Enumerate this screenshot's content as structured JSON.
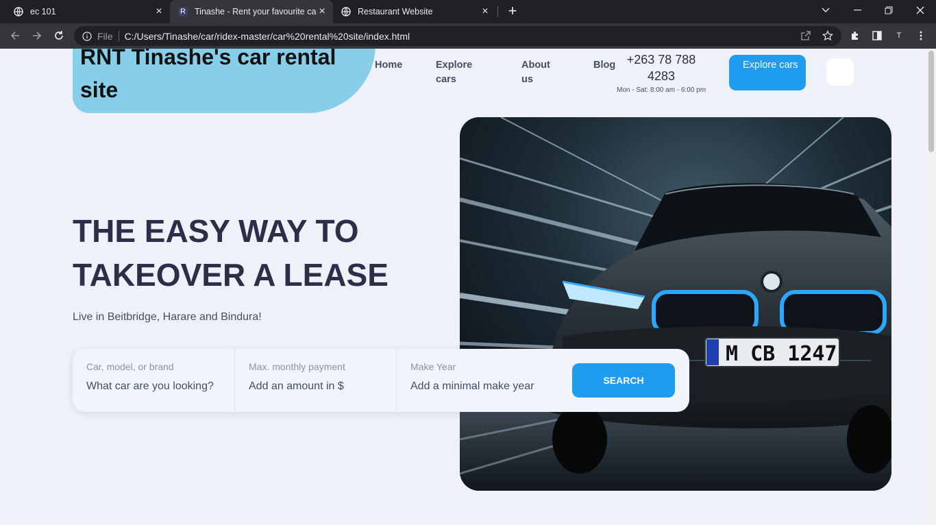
{
  "browser": {
    "tabs": [
      {
        "title": "ec 101",
        "icon": "globe-icon"
      },
      {
        "title": "Tinashe - Rent your favourite car",
        "icon": "r-letter-icon",
        "favicon_letter": "R",
        "active": true
      },
      {
        "title": "Restaurant Website",
        "icon": "globe-icon"
      }
    ],
    "address": {
      "scheme": "File",
      "url": "C:/Users/Tinashe/car/ridex-master/car%20rental%20site/index.html"
    },
    "profile_initial": "T"
  },
  "header": {
    "brand": "RNT Tinashe's car rental site",
    "nav": [
      "Home",
      "Explore cars",
      "About us",
      "Blog"
    ],
    "phone": "+263 78 788 4283",
    "hours": "Mon - Sat: 8:00 am - 6:00 pm",
    "cta": "Explore cars"
  },
  "hero": {
    "title": "THE EASY WAY TO TAKEOVER A LEASE",
    "subtitle": "Live in Beitbridge, Harare and Bindura!",
    "license_plate": "M CB 1247"
  },
  "search": {
    "fields": [
      {
        "label": "Car, model, or brand",
        "placeholder": "What car are you looking?"
      },
      {
        "label": "Max. monthly payment",
        "placeholder": "Add an amount in $"
      },
      {
        "label": "Make Year",
        "placeholder": "Add a minimal make year"
      }
    ],
    "button": "SEARCH"
  },
  "colors": {
    "brand_bg": "#87ceeb",
    "accent": "#1f9bf0",
    "page_bg": "#eef1f7",
    "headline": "#2c2e4a"
  }
}
